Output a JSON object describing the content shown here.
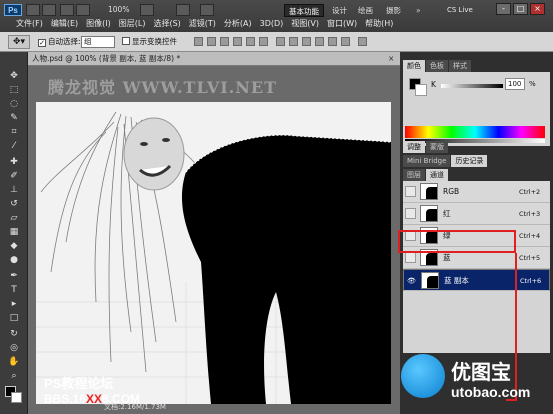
{
  "app": {
    "logo": "Ps",
    "zoom": "100%",
    "workspaces": [
      "基本功能",
      "设计",
      "绘画",
      "摄影"
    ],
    "active_workspace": "基本功能",
    "cs_live": "CS Live",
    "window_controls": [
      "-",
      "□",
      "×"
    ]
  },
  "menu": [
    "文件(F)",
    "编辑(E)",
    "图像(I)",
    "图层(L)",
    "选择(S)",
    "滤镜(T)",
    "分析(A)",
    "3D(D)",
    "视图(V)",
    "窗口(W)",
    "帮助(H)"
  ],
  "options": {
    "auto_select_label": "自动选择:",
    "auto_select_value": "组",
    "show_transform_label": "显示变换控件"
  },
  "document": {
    "tab_title": "人物.psd @ 100% (背景 副本, 蓝 副本/8) *",
    "watermark": "腾龙视觉 WWW.TLVI.NET",
    "status": "文档:2.16M/1.73M",
    "forum_line1": "PS教程论坛",
    "forum_line2_a": "BBS.16",
    "forum_line2_b": "XX",
    "forum_line2_c": "8.COM"
  },
  "color_panel": {
    "tabs": [
      "颜色",
      "色板",
      "样式"
    ],
    "channel_label": "K",
    "value": "100",
    "unit": "%"
  },
  "adjust_panel": {
    "tabs": [
      "调整",
      "蒙版"
    ]
  },
  "history_panel": {
    "tabs": [
      "Mini Bridge",
      "历史记录"
    ]
  },
  "channels_panel": {
    "tabs": [
      "图层",
      "通道"
    ],
    "rows": [
      {
        "name": "RGB",
        "key": "Ctrl+2",
        "visible": false,
        "selected": false
      },
      {
        "name": "红",
        "key": "Ctrl+3",
        "visible": false,
        "selected": false
      },
      {
        "name": "绿",
        "key": "Ctrl+4",
        "visible": false,
        "selected": false
      },
      {
        "name": "蓝",
        "key": "Ctrl+5",
        "visible": false,
        "selected": false
      },
      {
        "name": "蓝 副本",
        "key": "Ctrl+6",
        "visible": true,
        "selected": true
      }
    ]
  },
  "site_badge": {
    "name": "优图宝",
    "url": "utobao.com"
  },
  "colors": {
    "selection_blue": "#0a246a",
    "annotation_red": "#e02020",
    "active_tab": "#d4d4d4"
  }
}
